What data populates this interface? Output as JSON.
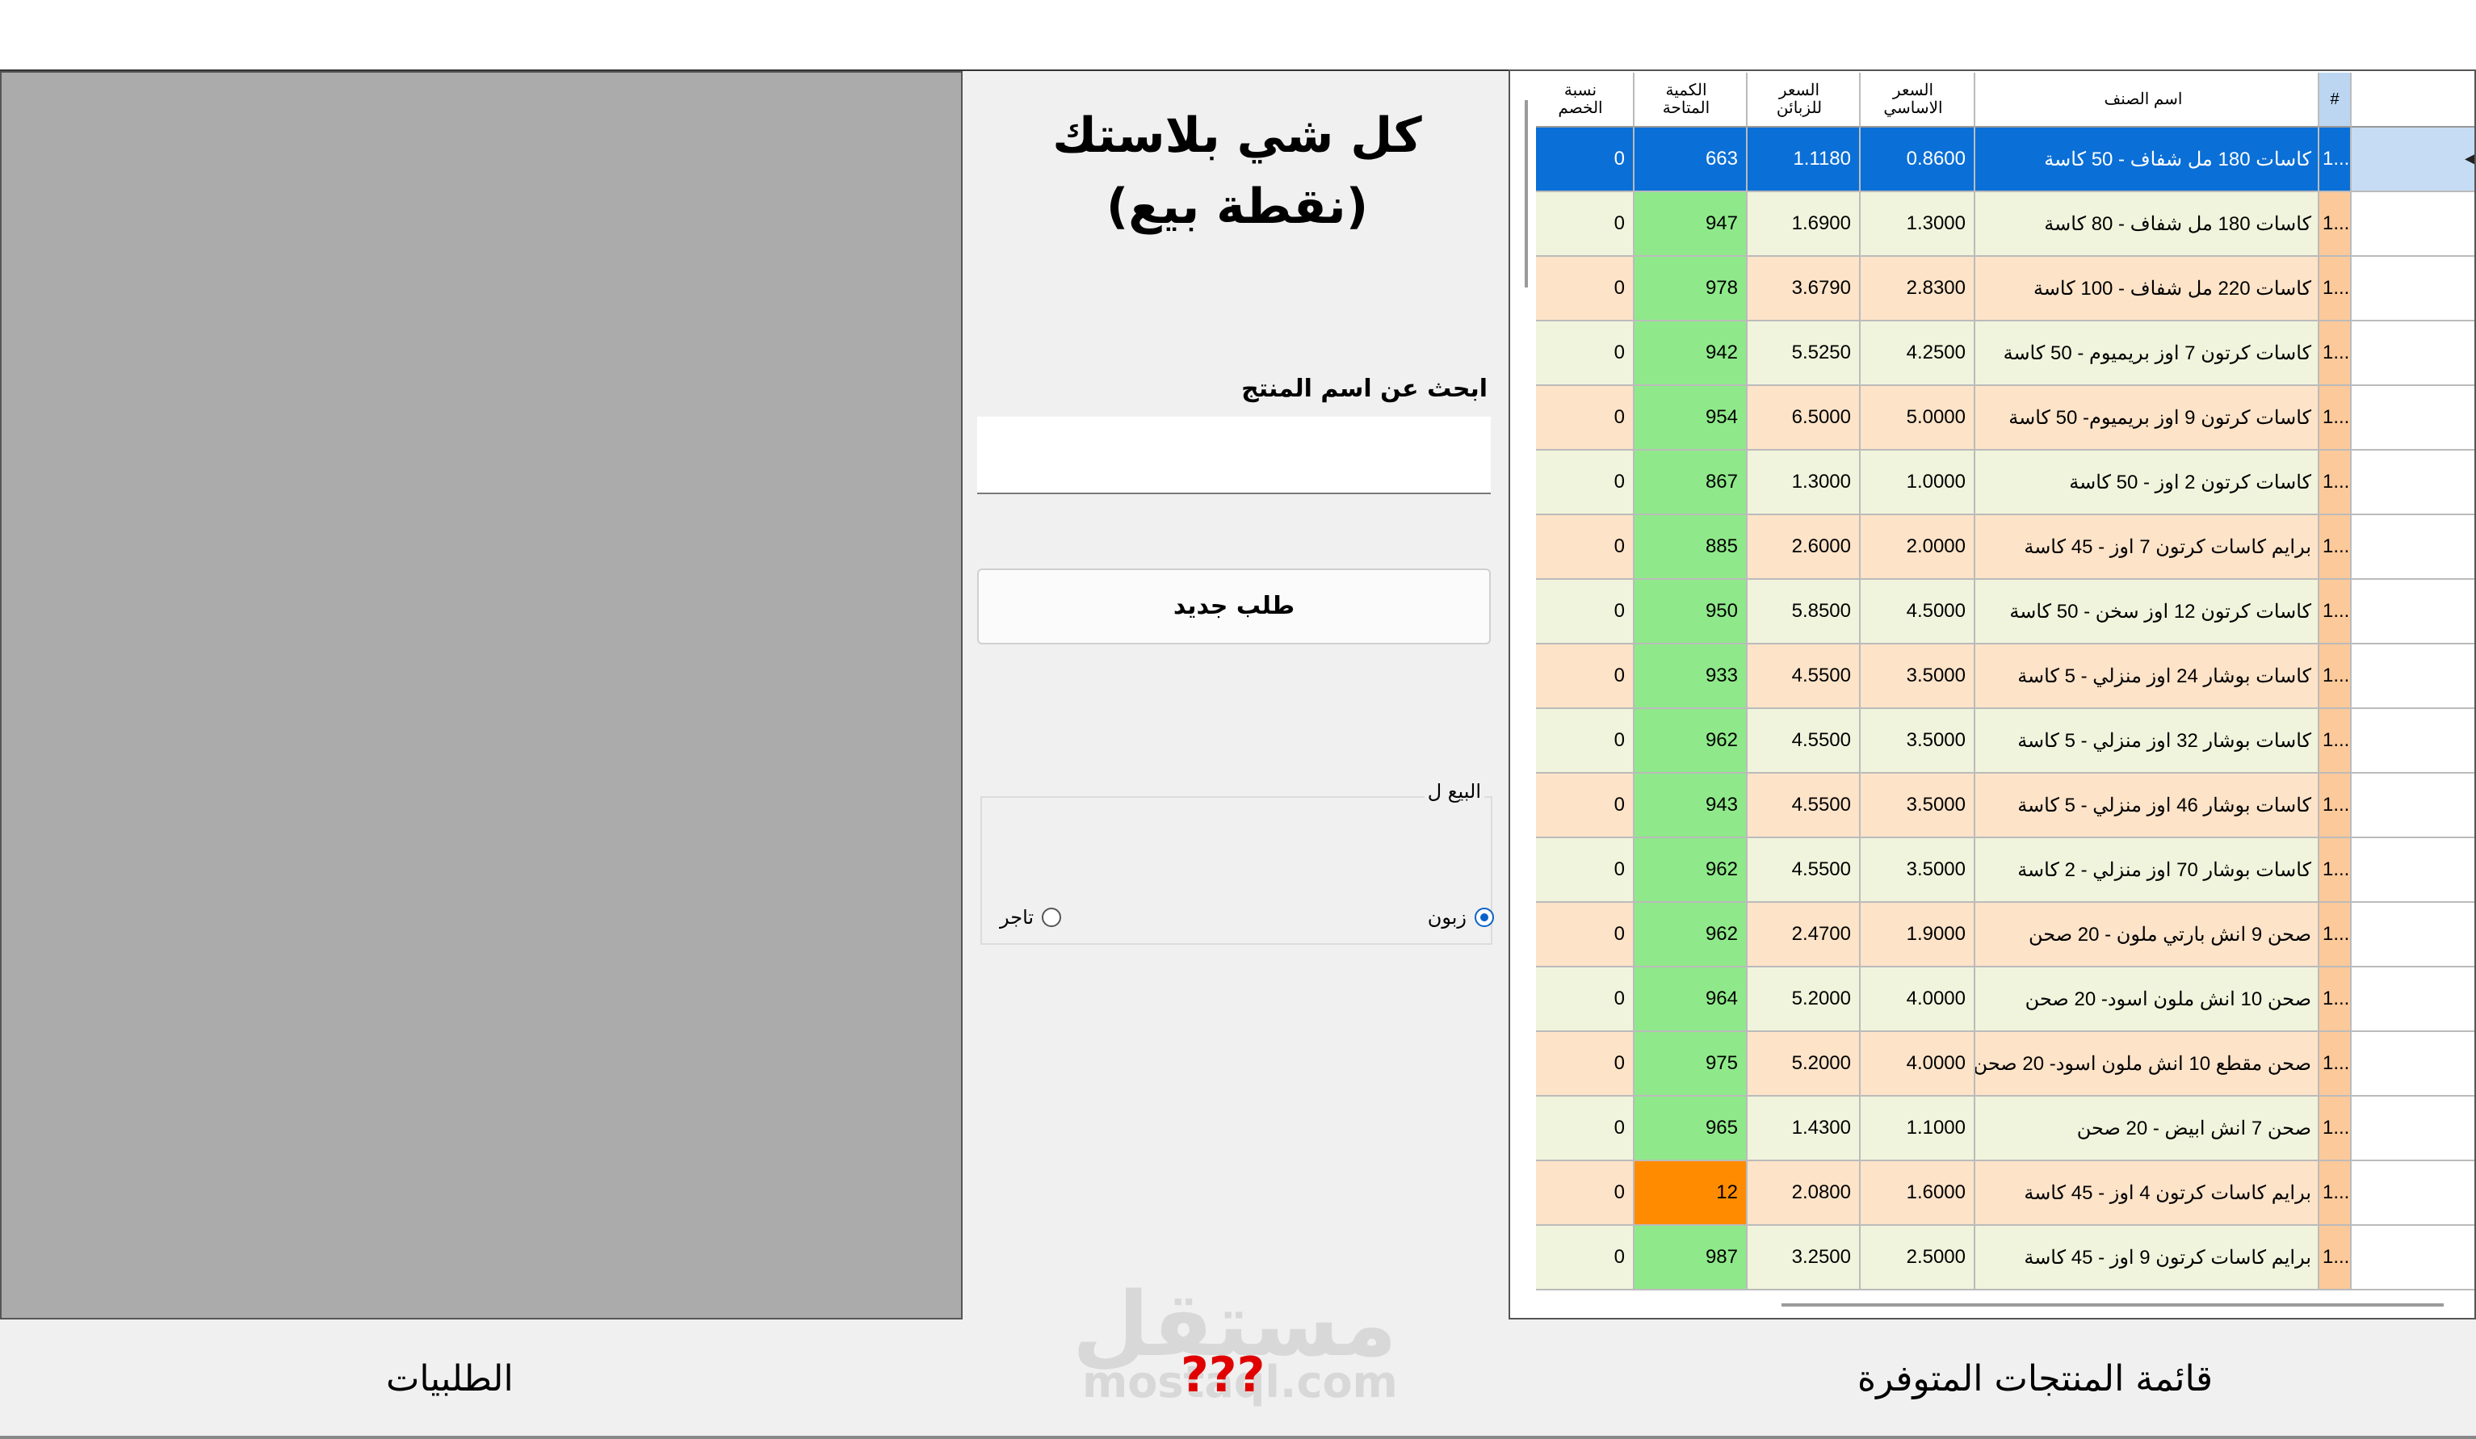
{
  "app": {
    "title": "كل شي بلاستك\n(نقطة بيع)"
  },
  "search": {
    "label": "ابحث عن اسم المنتج",
    "value": "",
    "placeholder": ""
  },
  "actions": {
    "new_order_label": "طلب جديد"
  },
  "sale_for": {
    "legend": "البيع ل",
    "options": [
      {
        "label": "زبون",
        "checked": true
      },
      {
        "label": "تاجر",
        "checked": false
      }
    ]
  },
  "grid": {
    "columns": {
      "number": "#",
      "name": "اسم الصنف",
      "base_price": "السعر\nالاساسي",
      "customer_price": "السعر\nللزبائن",
      "quantity": "الكمية\nالمتاحة",
      "discount": "نسبة\nالخصم"
    },
    "rows": [
      {
        "num": "1...",
        "name": "كاسات 180 مل شفاف - 50 كاسة",
        "base": "0.8600",
        "customer": "1.1180",
        "qty": "663",
        "discount": "0",
        "selected": true,
        "tone": "cream"
      },
      {
        "num": "1...",
        "name": "كاسات 180 مل شفاف - 80 كاسة",
        "base": "1.3000",
        "customer": "1.6900",
        "qty": "947",
        "discount": "0",
        "tone": "cream"
      },
      {
        "num": "1...",
        "name": "كاسات 220 مل شفاف - 100 كاسة",
        "base": "2.8300",
        "customer": "3.6790",
        "qty": "978",
        "discount": "0",
        "tone": "peach"
      },
      {
        "num": "1...",
        "name": "كاسات كرتون 7 اوز بريميوم - 50 كاسة",
        "base": "4.2500",
        "customer": "5.5250",
        "qty": "942",
        "discount": "0",
        "tone": "cream"
      },
      {
        "num": "1...",
        "name": "كاسات كرتون 9 اوز بريميوم- 50 كاسة",
        "base": "5.0000",
        "customer": "6.5000",
        "qty": "954",
        "discount": "0",
        "tone": "peach"
      },
      {
        "num": "1...",
        "name": "كاسات كرتون 2 اوز - 50 كاسة",
        "base": "1.0000",
        "customer": "1.3000",
        "qty": "867",
        "discount": "0",
        "tone": "cream"
      },
      {
        "num": "1...",
        "name": "برايم كاسات كرتون 7 اوز - 45 كاسة",
        "base": "2.0000",
        "customer": "2.6000",
        "qty": "885",
        "discount": "0",
        "tone": "peach"
      },
      {
        "num": "1...",
        "name": "كاسات كرتون 12 اوز سخن - 50 كاسة",
        "base": "4.5000",
        "customer": "5.8500",
        "qty": "950",
        "discount": "0",
        "tone": "cream"
      },
      {
        "num": "1...",
        "name": "كاسات بوشار 24 اوز منزلي - 5 كاسة",
        "base": "3.5000",
        "customer": "4.5500",
        "qty": "933",
        "discount": "0",
        "tone": "peach"
      },
      {
        "num": "1...",
        "name": "كاسات بوشار 32 اوز منزلي - 5 كاسة",
        "base": "3.5000",
        "customer": "4.5500",
        "qty": "962",
        "discount": "0",
        "tone": "cream"
      },
      {
        "num": "1...",
        "name": "كاسات بوشار 46 اوز منزلي - 5 كاسة",
        "base": "3.5000",
        "customer": "4.5500",
        "qty": "943",
        "discount": "0",
        "tone": "peach"
      },
      {
        "num": "1...",
        "name": "كاسات بوشار 70 اوز منزلي - 2 كاسة",
        "base": "3.5000",
        "customer": "4.5500",
        "qty": "962",
        "discount": "0",
        "tone": "cream"
      },
      {
        "num": "1...",
        "name": "صحن 9 انش بارتي ملون - 20 صحن",
        "base": "1.9000",
        "customer": "2.4700",
        "qty": "962",
        "discount": "0",
        "tone": "peach"
      },
      {
        "num": "1...",
        "name": "صحن 10 انش ملون اسود- 20 صحن",
        "base": "4.0000",
        "customer": "5.2000",
        "qty": "964",
        "discount": "0",
        "tone": "cream"
      },
      {
        "num": "1...",
        "name": "صحن مقطع 10 انش ملون اسود- 20 صحن",
        "base": "4.0000",
        "customer": "5.2000",
        "qty": "975",
        "discount": "0",
        "tone": "peach"
      },
      {
        "num": "1...",
        "name": "صحن 7 انش ابيض - 20 صحن",
        "base": "1.1000",
        "customer": "1.4300",
        "qty": "965",
        "discount": "0",
        "tone": "cream"
      },
      {
        "num": "1...",
        "name": "برايم كاسات كرتون 4 اوز - 45 كاسة",
        "base": "1.6000",
        "customer": "2.0800",
        "qty": "12",
        "discount": "0",
        "tone": "peach",
        "low": true
      },
      {
        "num": "1...",
        "name": "برايم كاسات كرتون 9 اوز - 45 كاسة",
        "base": "2.5000",
        "customer": "3.2500",
        "qty": "987",
        "discount": "0",
        "tone": "cream"
      }
    ]
  },
  "labels": {
    "products": "قائمة المنتجات المتوفرة",
    "orders": "الطلبيات",
    "unknown": "???"
  },
  "watermark": {
    "arabic": "مستقل",
    "latin": "mostaql.com"
  },
  "icons": {
    "row_indicator": "triangle-left",
    "radio": "circle"
  },
  "colors": {
    "selected_row": "#0a6fd6",
    "quantity_ok": "#8fe98a",
    "quantity_low": "#ff8c00",
    "row_peach": "#fde3c8",
    "row_cream": "#f1f4dc",
    "question_marks": "#e00000"
  }
}
